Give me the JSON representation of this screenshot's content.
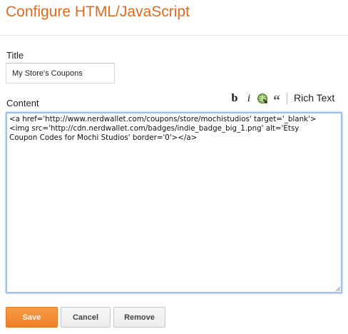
{
  "dialog": {
    "title": "Configure HTML/JavaScript"
  },
  "title_field": {
    "label": "Title",
    "value": "My Store's Coupons"
  },
  "content_field": {
    "label": "Content",
    "value": "<a href='http://www.nerdwallet.com/coupons/store/mochistudios' target='_blank'>\n<img src='http://cdn.nerdwallet.com/badges/indie_badge_big_1.png' alt='Etsy\nCoupon Codes for Mochi Studios' border='0'></a>"
  },
  "toolbar": {
    "bold_glyph": "b",
    "italic_glyph": "i",
    "link_icon": "link-icon",
    "quote_glyph": "“",
    "rich_text_label": "Rich Text"
  },
  "buttons": {
    "save_label": "Save",
    "cancel_label": "Cancel",
    "remove_label": "Remove"
  },
  "colors": {
    "title_accent": "#dd6a1f",
    "save_button": "#f17f29",
    "textarea_focus_border": "#9ec2ee"
  }
}
